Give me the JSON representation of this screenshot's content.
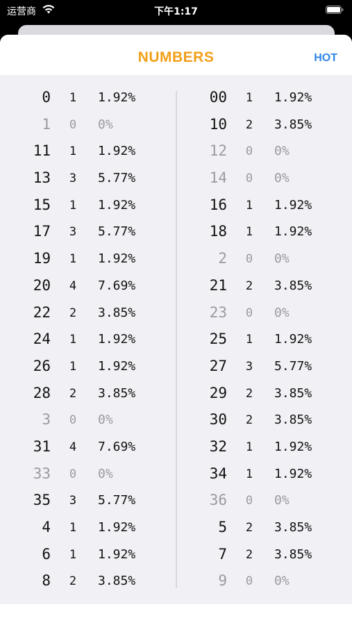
{
  "status_bar": {
    "carrier": "运营商",
    "time": "下午1:17"
  },
  "nav": {
    "title": "NUMBERS",
    "hot_label": "HOT"
  },
  "colors": {
    "accent_title": "#f2a019",
    "link": "#2f86e6"
  },
  "left_column": [
    {
      "number": "0",
      "count": "1",
      "percent": "1.92%"
    },
    {
      "number": "1",
      "count": "0",
      "percent": "0%"
    },
    {
      "number": "11",
      "count": "1",
      "percent": "1.92%"
    },
    {
      "number": "13",
      "count": "3",
      "percent": "5.77%"
    },
    {
      "number": "15",
      "count": "1",
      "percent": "1.92%"
    },
    {
      "number": "17",
      "count": "3",
      "percent": "5.77%"
    },
    {
      "number": "19",
      "count": "1",
      "percent": "1.92%"
    },
    {
      "number": "20",
      "count": "4",
      "percent": "7.69%"
    },
    {
      "number": "22",
      "count": "2",
      "percent": "3.85%"
    },
    {
      "number": "24",
      "count": "1",
      "percent": "1.92%"
    },
    {
      "number": "26",
      "count": "1",
      "percent": "1.92%"
    },
    {
      "number": "28",
      "count": "2",
      "percent": "3.85%"
    },
    {
      "number": "3",
      "count": "0",
      "percent": "0%"
    },
    {
      "number": "31",
      "count": "4",
      "percent": "7.69%"
    },
    {
      "number": "33",
      "count": "0",
      "percent": "0%"
    },
    {
      "number": "35",
      "count": "3",
      "percent": "5.77%"
    },
    {
      "number": "4",
      "count": "1",
      "percent": "1.92%"
    },
    {
      "number": "6",
      "count": "1",
      "percent": "1.92%"
    },
    {
      "number": "8",
      "count": "2",
      "percent": "3.85%"
    }
  ],
  "right_column": [
    {
      "number": "00",
      "count": "1",
      "percent": "1.92%"
    },
    {
      "number": "10",
      "count": "2",
      "percent": "3.85%"
    },
    {
      "number": "12",
      "count": "0",
      "percent": "0%"
    },
    {
      "number": "14",
      "count": "0",
      "percent": "0%"
    },
    {
      "number": "16",
      "count": "1",
      "percent": "1.92%"
    },
    {
      "number": "18",
      "count": "1",
      "percent": "1.92%"
    },
    {
      "number": "2",
      "count": "0",
      "percent": "0%"
    },
    {
      "number": "21",
      "count": "2",
      "percent": "3.85%"
    },
    {
      "number": "23",
      "count": "0",
      "percent": "0%"
    },
    {
      "number": "25",
      "count": "1",
      "percent": "1.92%"
    },
    {
      "number": "27",
      "count": "3",
      "percent": "5.77%"
    },
    {
      "number": "29",
      "count": "2",
      "percent": "3.85%"
    },
    {
      "number": "30",
      "count": "2",
      "percent": "3.85%"
    },
    {
      "number": "32",
      "count": "1",
      "percent": "1.92%"
    },
    {
      "number": "34",
      "count": "1",
      "percent": "1.92%"
    },
    {
      "number": "36",
      "count": "0",
      "percent": "0%"
    },
    {
      "number": "5",
      "count": "2",
      "percent": "3.85%"
    },
    {
      "number": "7",
      "count": "2",
      "percent": "3.85%"
    },
    {
      "number": "9",
      "count": "0",
      "percent": "0%"
    }
  ]
}
